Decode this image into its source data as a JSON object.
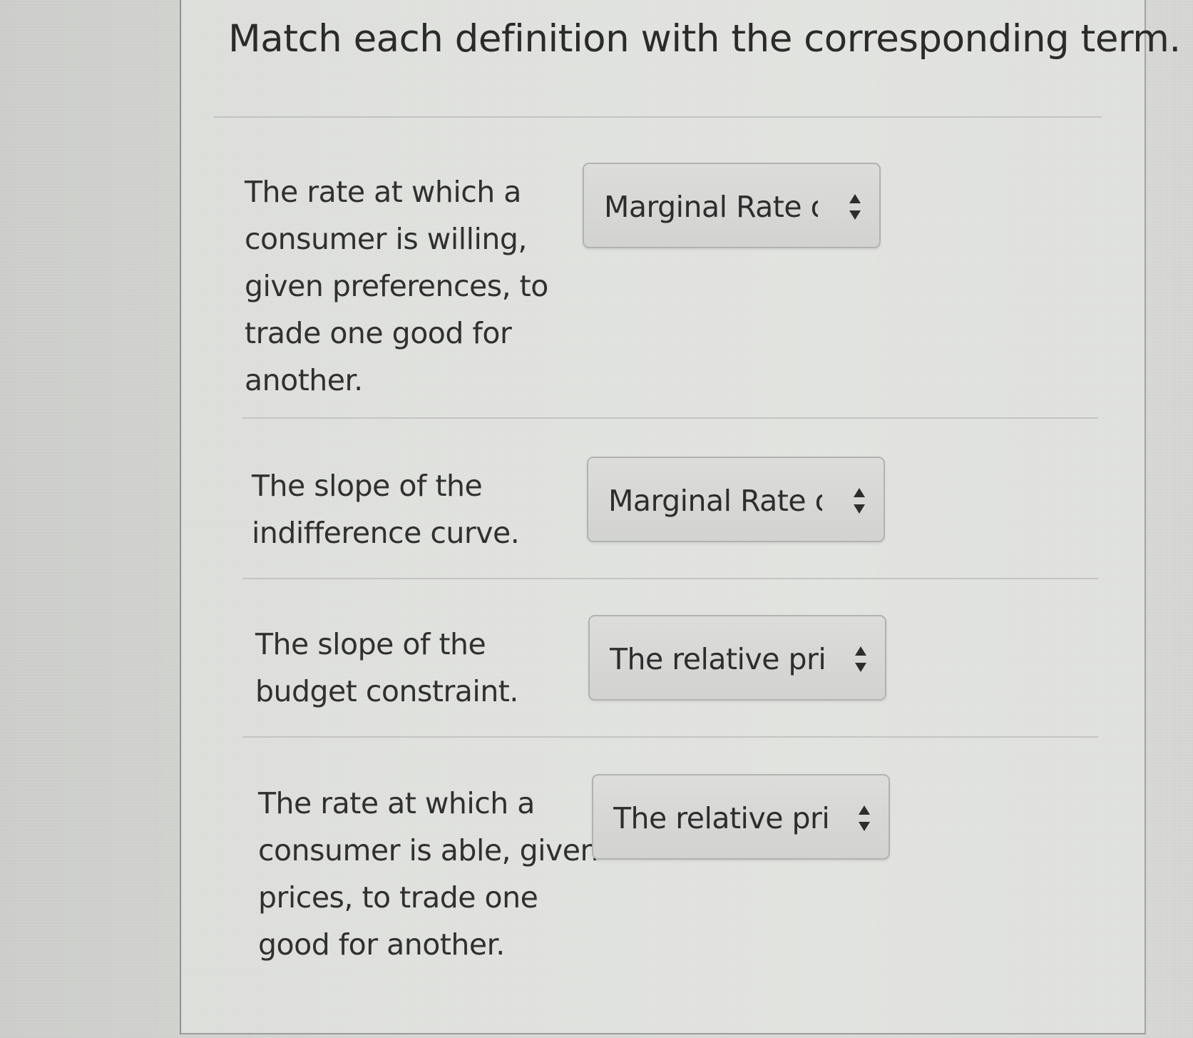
{
  "title": "Match each definition with the corresponding term.",
  "items": [
    {
      "definition": [
        "The rate at which a",
        "consumer is willing,",
        "given preferences, to",
        "trade one good for",
        "another."
      ],
      "selected": "Marginal Rate o"
    },
    {
      "definition": [
        "The slope of the",
        "indifference curve."
      ],
      "selected": "Marginal Rate o"
    },
    {
      "definition": [
        "The slope of the",
        "budget constraint."
      ],
      "selected": "The relative pric"
    },
    {
      "definition": [
        "The rate at which a",
        "consumer is able, given",
        "prices, to trade one",
        "good for another."
      ],
      "selected": "The relative pric"
    }
  ],
  "icons": {
    "select_arrows": "up-down-chevron-icon"
  }
}
